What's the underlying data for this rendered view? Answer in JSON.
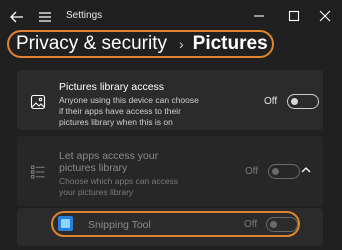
{
  "window": {
    "title": "Settings"
  },
  "breadcrumb": {
    "parent": "Privacy & security",
    "separator": "›",
    "current": "Pictures"
  },
  "pictures_library_access": {
    "title": "Pictures library access",
    "description_lines": [
      "Anyone using this device can choose",
      "if their apps have access to their",
      "pictures library when this is on"
    ],
    "state": "Off",
    "enabled": false
  },
  "let_apps_access": {
    "title_lines": [
      "Let apps access your",
      "pictures library"
    ],
    "description_lines": [
      "Choose which apps can access",
      "your pictures library"
    ],
    "state": "Off",
    "enabled": false,
    "expanded": true
  },
  "apps": [
    {
      "name": "Snipping Tool",
      "state": "Off",
      "enabled": false
    }
  ],
  "colors": {
    "highlight": "#e0852e",
    "background": "#202020",
    "panel": "#2b2b2b"
  },
  "icons": [
    "back-arrow-icon",
    "hamburger-menu-icon",
    "minimize-icon",
    "maximize-icon",
    "close-icon",
    "picture-icon",
    "list-icon",
    "chevron-up-icon",
    "snipping-tool-icon"
  ]
}
